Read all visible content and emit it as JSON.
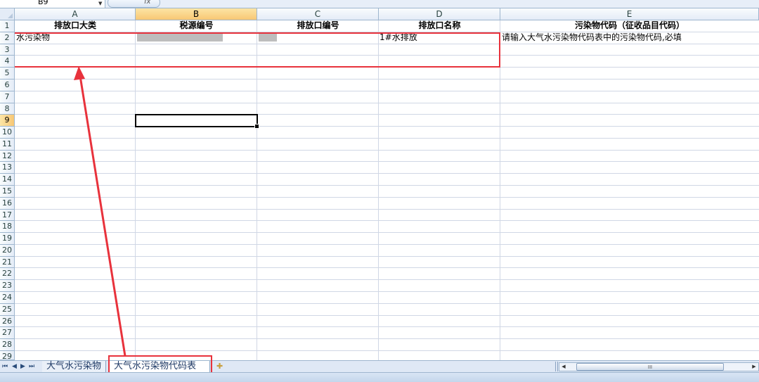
{
  "formula_bar": {
    "name_box": "B9",
    "fx_label": "fx"
  },
  "columns": [
    "A",
    "B",
    "C",
    "D",
    "E"
  ],
  "rows": [
    "1",
    "2",
    "3",
    "4",
    "5",
    "6",
    "7",
    "8",
    "9",
    "10",
    "11",
    "12",
    "13",
    "14",
    "15",
    "16",
    "17",
    "18",
    "19",
    "20",
    "21",
    "22",
    "23",
    "24",
    "25",
    "26",
    "27",
    "28",
    "29"
  ],
  "selected": {
    "column": "B",
    "row": "9"
  },
  "sheet": {
    "headers": [
      "排放口大类",
      "税源编号",
      "排放口编号",
      "排放口名称",
      "污染物代码（征收品目代码）"
    ],
    "row2": {
      "a": "水污染物",
      "d": "1#水排放",
      "e": "请输入大气水污染物代码表中的污染物代码,必填"
    }
  },
  "sheet_tabs": [
    {
      "label": "大气水污染物",
      "active": false
    },
    {
      "label": "大气水污染物代码表",
      "active": true
    }
  ],
  "nav_buttons": [
    "⏮",
    "◀",
    "▶",
    "⏭"
  ],
  "scrollbar": {
    "thumb_grip": "III"
  },
  "colors": {
    "annotation": "#e8323c",
    "selection_header": "#f8c774",
    "gridline": "#d0d7e5"
  }
}
